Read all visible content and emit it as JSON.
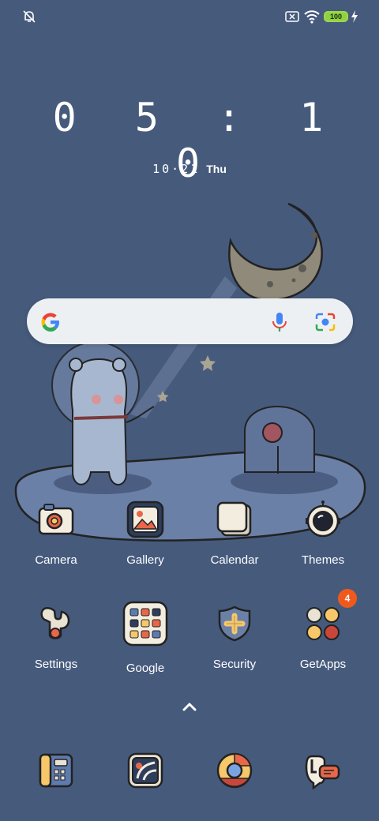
{
  "clock": {
    "time": "0 5 : 1 0",
    "date": "10·21",
    "weekday": "Thu"
  },
  "status": {
    "battery": "100"
  },
  "apps_row1": [
    {
      "label": "Camera"
    },
    {
      "label": "Gallery"
    },
    {
      "label": "Calendar"
    },
    {
      "label": "Themes"
    }
  ],
  "apps_row2": [
    {
      "label": "Settings"
    },
    {
      "label": "Google"
    },
    {
      "label": "Security"
    },
    {
      "label": "GetApps",
      "badge": "4"
    }
  ],
  "dock": [
    {
      "icon": "phone-icon"
    },
    {
      "icon": "browser-icon"
    },
    {
      "icon": "chrome-icon"
    },
    {
      "icon": "messages-icon"
    }
  ],
  "colors": {
    "background": "#465a7c",
    "badge": "#ef5a1c",
    "battery": "#8fd13f"
  }
}
